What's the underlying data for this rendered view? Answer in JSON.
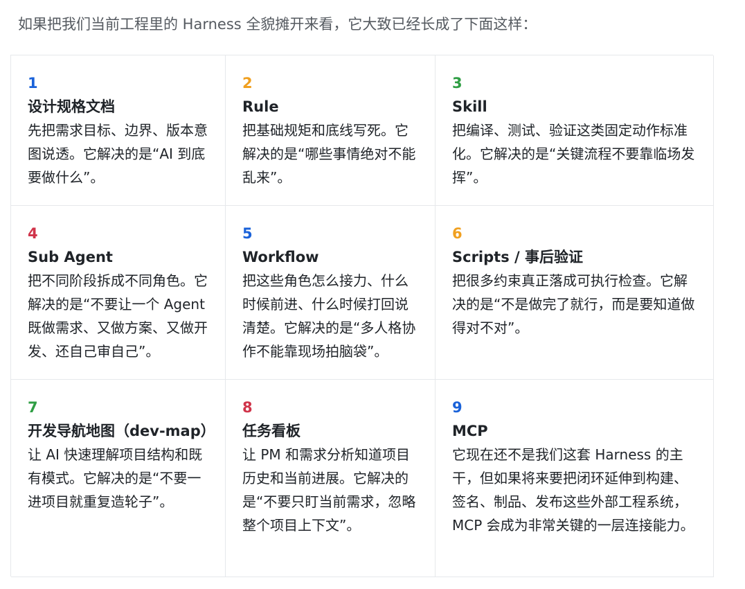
{
  "intro": "如果把我们当前工程里的 Harness 全貌摊开来看，它大致已经长成了下面这样：",
  "colors": {
    "blue": "#1a62d9",
    "orange": "#f0a020",
    "green": "#2f9e44",
    "red": "#d0344a"
  },
  "cards": [
    {
      "number": "1",
      "title": "设计规格文档",
      "description": "先把需求目标、边界、版本意图说透。它解决的是“AI 到底要做什么”。"
    },
    {
      "number": "2",
      "title": "Rule",
      "description": "把基础规矩和底线写死。它解决的是“哪些事情绝对不能乱来”。"
    },
    {
      "number": "3",
      "title": "Skill",
      "description": "把编译、测试、验证这类固定动作标准化。它解决的是“关键流程不要靠临场发挥”。"
    },
    {
      "number": "4",
      "title": "Sub Agent",
      "description": "把不同阶段拆成不同角色。它解决的是“不要让一个 Agent 既做需求、又做方案、又做开发、还自己审自己”。"
    },
    {
      "number": "5",
      "title": "Workflow",
      "description": "把这些角色怎么接力、什么时候前进、什么时候打回说清楚。它解决的是“多人格协作不能靠现场拍脑袋”。"
    },
    {
      "number": "6",
      "title": "Scripts / 事后验证",
      "description": "把很多约束真正落成可执行检查。它解决的是“不是做完了就行，而是要知道做得对不对”。"
    },
    {
      "number": "7",
      "title": "开发导航地图（dev-map）",
      "description": "让 AI 快速理解项目结构和既有模式。它解决的是“不要一进项目就重复造轮子”。"
    },
    {
      "number": "8",
      "title": "任务看板",
      "description": "让 PM 和需求分析知道项目历史和当前进展。它解决的是“不要只盯当前需求，忽略整个项目上下文”。"
    },
    {
      "number": "9",
      "title": "MCP",
      "description": "它现在还不是我们这套 Harness 的主干，但如果将来要把闭环延伸到构建、签名、制品、发布这些外部工程系统，MCP 会成为非常关键的一层连接能力。"
    }
  ]
}
